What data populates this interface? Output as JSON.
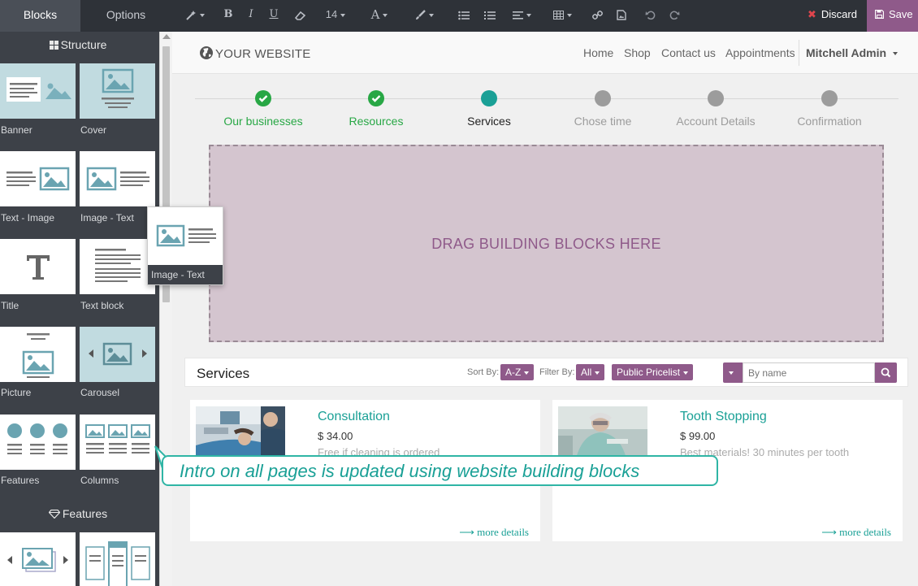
{
  "toolbar": {
    "tabs": [
      {
        "label": "Blocks",
        "active": true
      },
      {
        "label": "Options",
        "active": false
      }
    ],
    "font_size": "14",
    "bold": "B",
    "italic": "I",
    "underline": "U",
    "discard_label": "Discard",
    "save_label": "Save"
  },
  "sidebar": {
    "structure_title": "Structure",
    "features_title": "Features",
    "blocks": [
      {
        "label": "Banner"
      },
      {
        "label": "Cover"
      },
      {
        "label": "Text - Image"
      },
      {
        "label": "Image - Text"
      },
      {
        "label": "Title"
      },
      {
        "label": "Text block"
      },
      {
        "label": "Picture"
      },
      {
        "label": "Carousel"
      },
      {
        "label": "Features"
      },
      {
        "label": "Columns"
      }
    ],
    "dragging_label": "Image - Text"
  },
  "site": {
    "logo": "YOUR WEBSITE",
    "nav": [
      "Home",
      "Shop",
      "Contact us",
      "Appointments"
    ],
    "user": "Mitchell Admin"
  },
  "steps": [
    {
      "label": "Our businesses",
      "state": "done"
    },
    {
      "label": "Resources",
      "state": "done"
    },
    {
      "label": "Services",
      "state": "current"
    },
    {
      "label": "Chose time",
      "state": "todo"
    },
    {
      "label": "Account Details",
      "state": "todo"
    },
    {
      "label": "Confirmation",
      "state": "todo"
    }
  ],
  "dropzone_text": "DRAG BUILDING BLOCKS HERE",
  "services": {
    "title": "Services",
    "sort_label": "Sort By:",
    "sort_value": "A-Z",
    "filter_label": "Filter By:",
    "filter_value": "All",
    "pricelist": "Public Pricelist",
    "search_placeholder": "By name",
    "cards": [
      {
        "title": "Consultation",
        "price": "$ 34.00",
        "desc": "Free if cleaning is ordered",
        "more": "more details"
      },
      {
        "title": "Tooth Stopping",
        "price": "$ 99.00",
        "desc": "Best materials! 30 minutes per tooth",
        "more": "more details"
      }
    ]
  },
  "callout": "Intro on all pages is updated using website building blocks",
  "colors": {
    "accent": "#8f5a8a",
    "teal": "#1aa096",
    "done": "#28a745",
    "toolbar": "#2e3238",
    "panel": "#3d4148"
  }
}
